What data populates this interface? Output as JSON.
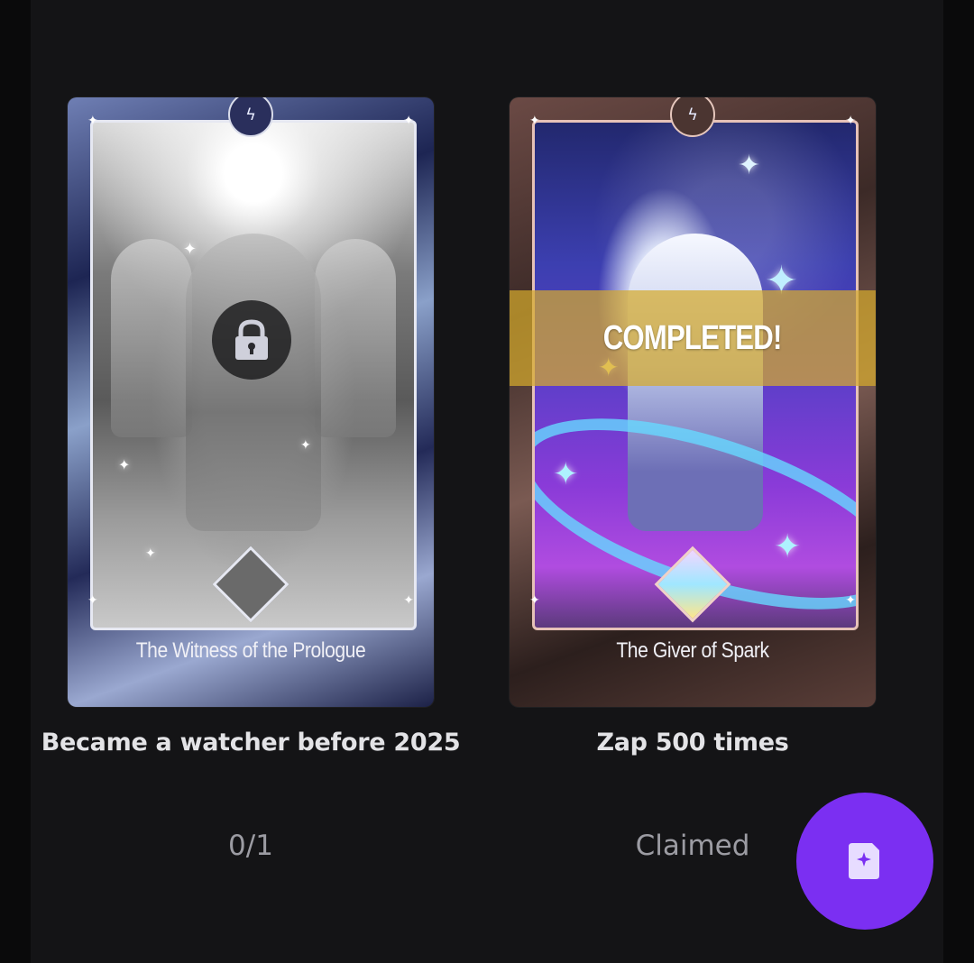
{
  "cards": [
    {
      "card_title": "The Witness of the Prologue",
      "caption": "Became a watcher before 2025",
      "status": "0/1",
      "locked": true
    },
    {
      "card_title": "The Giver of Spark",
      "caption": "Zap 500 times",
      "status": "Claimed",
      "banner": "COMPLETED!",
      "locked": false
    }
  ],
  "fab": {
    "icon": "sparkle-document-icon",
    "color": "#7b2ff2"
  },
  "colors": {
    "background": "#141416",
    "banner": "#d6aa2c",
    "status_text": "#9c9ca3"
  }
}
